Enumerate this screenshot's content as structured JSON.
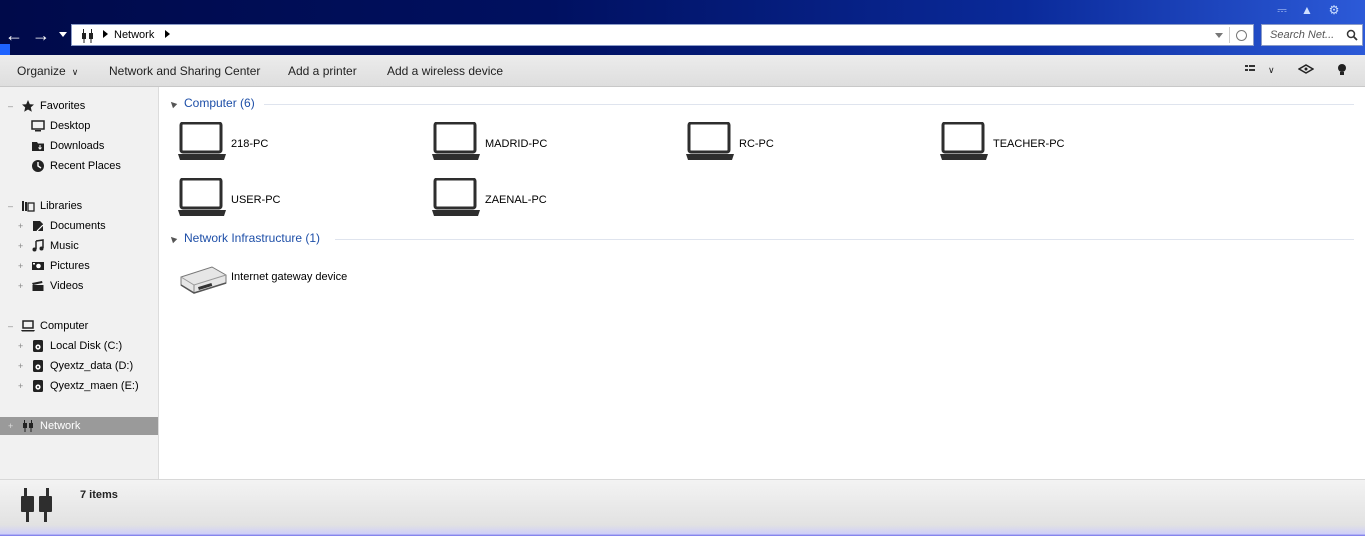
{
  "address": {
    "breadcrumb": [
      "Network"
    ],
    "icon": "network-icon"
  },
  "search": {
    "placeholder": "Search Net..."
  },
  "toolbar": {
    "organize": "Organize",
    "network_sharing": "Network and Sharing Center",
    "add_printer": "Add a printer",
    "add_wireless": "Add a wireless device"
  },
  "sidebar": {
    "favorites": {
      "label": "Favorites",
      "items": [
        "Desktop",
        "Downloads",
        "Recent Places"
      ]
    },
    "libraries": {
      "label": "Libraries",
      "items": [
        "Documents",
        "Music",
        "Pictures",
        "Videos"
      ]
    },
    "computer": {
      "label": "Computer",
      "items": [
        "Local Disk (C:)",
        "Qyextz_data (D:)",
        "Qyextz_maen (E:)"
      ]
    },
    "network": {
      "label": "Network"
    }
  },
  "groups": [
    {
      "title": "Computer (6)",
      "items": [
        "218-PC",
        "MADRID-PC",
        "RC-PC",
        "TEACHER-PC",
        "USER-PC",
        "ZAENAL-PC"
      ]
    },
    {
      "title": "Network Infrastructure (1)",
      "items": [
        "Internet gateway device"
      ]
    }
  ],
  "status": {
    "count": "7 items"
  },
  "colors": {
    "accent": "#1e4fa8",
    "titlebar": "#001060",
    "selection": "#9a9a9a"
  }
}
